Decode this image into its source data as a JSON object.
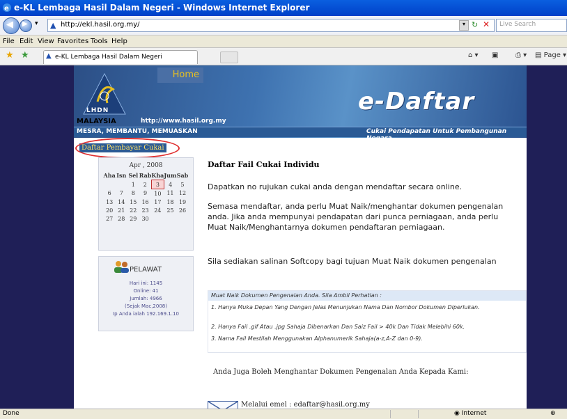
{
  "window": {
    "title": "e-KL Lembaga Hasil Dalam Negeri - Windows Internet Explorer"
  },
  "address": {
    "url": "http://ekl.hasil.org.my/",
    "search_placeholder": "Live Search"
  },
  "menu": [
    "File",
    "Edit",
    "View",
    "Favorites",
    "Tools",
    "Help"
  ],
  "tab": {
    "title": "e-KL Lembaga Hasil Dalam Negeri"
  },
  "toolbar": {
    "page_label": "Page"
  },
  "banner": {
    "home": "Home",
    "lhdn": "LHDN",
    "malaysia": "MALAYSIA",
    "url": "http://www.hasil.org.my",
    "edaftar": "e-Daftar",
    "motto": "MESRA, MEMBANTU, MEMUASKAN",
    "slogan": "Cukai Pendapatan Untuk Pembangunan Negara"
  },
  "sidebar": {
    "daftar_link": "Daftar Pembayar Cukai",
    "calendar": {
      "month": "Apr , 2008",
      "days": [
        "Aha",
        "Isn",
        "Sel",
        "Rab",
        "Kha",
        "Jum",
        "Sab"
      ],
      "weeks": [
        [
          "",
          "",
          "1",
          "2",
          "3",
          "4",
          "5"
        ],
        [
          "6",
          "7",
          "8",
          "9",
          "10",
          "11",
          "12"
        ],
        [
          "13",
          "14",
          "15",
          "16",
          "17",
          "18",
          "19"
        ],
        [
          "20",
          "21",
          "22",
          "23",
          "24",
          "25",
          "26"
        ],
        [
          "27",
          "28",
          "29",
          "30",
          "",
          "",
          ""
        ]
      ],
      "today": "3"
    },
    "pelawat": {
      "title": "PELAWAT",
      "hari_ini": "Hari ini: 1145",
      "online": "Online: 41",
      "jumlah": "Jumlah: 4966",
      "sejak": "(Sejak Mac,2008)",
      "ip": "Ip Anda ialah 192.169.1.10"
    }
  },
  "content": {
    "heading": "Daftar Fail Cukai Individu",
    "para1": "Dapatkan no rujukan cukai anda dengan mendaftar secara online.",
    "para2": "Semasa mendaftar, anda perlu Muat Naik/menghantar dokumen pengenalan anda. Jika anda mempunyai pendapatan dari punca perniagaan, anda perlu Muat Naik/Menghantarnya dokumen pendaftaran perniagaan.",
    "para3": "Sila sediakan salinan Softcopy bagi tujuan Muat Naik dokumen pengenalan",
    "note": {
      "header": "Muat Naik Dokumen Pengenalan Anda. Sila Ambil Perhatian :",
      "items": [
        "1. Hanya Muka Depan Yang Dengan Jelas Menunjukan Nama Dan Nombor Dokumen Diperlukan.",
        "2. Hanya Fail .gif Atau .jpg Sahaja Dibenarkan Dan Saiz Fail > 40k Dan Tidak Melebihi 60k.",
        "3. Nama Fail Mestilah Menggunakan Alphanumerik Sahaja(a-z,A-Z dan 0-9)."
      ]
    },
    "hantar": "Anda Juga Boleh Menghantar Dokumen Pengenalan Anda Kepada Kami:",
    "email": "Melalui emel : edaftar@hasil.org.my"
  },
  "status": {
    "text": "Done",
    "zone": "Internet"
  }
}
